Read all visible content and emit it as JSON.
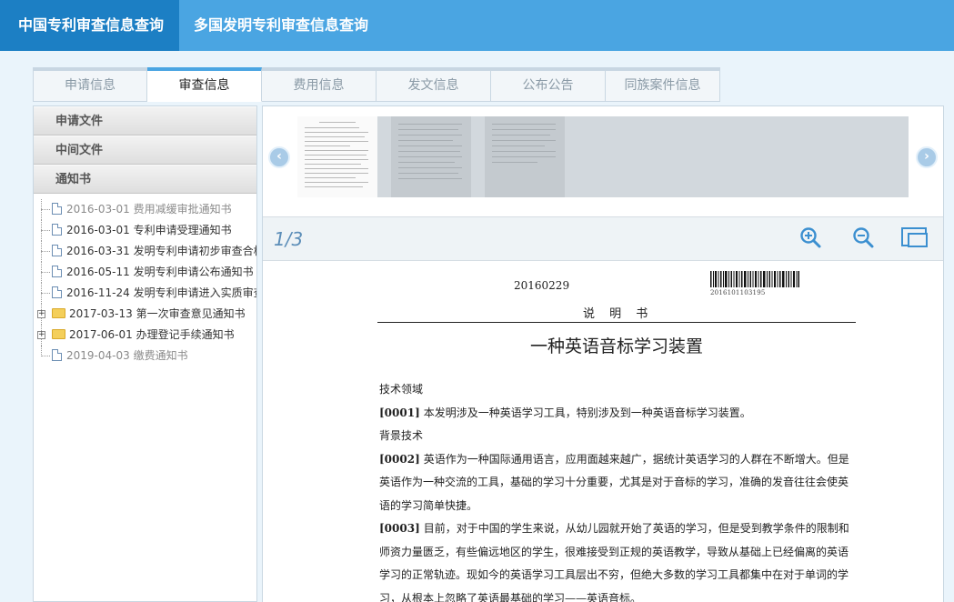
{
  "topnav": {
    "items": [
      "中国专利审查信息查询",
      "多国发明专利审查信息查询"
    ]
  },
  "tabs": [
    "申请信息",
    "审查信息",
    "费用信息",
    "发文信息",
    "公布公告",
    "同族案件信息"
  ],
  "sidebar": {
    "sections": [
      "申请文件",
      "中间文件",
      "通知书"
    ],
    "notices": [
      {
        "date": "2016-03-01",
        "label": "费用减缓审批通知书"
      },
      {
        "date": "2016-03-01",
        "label": "专利申请受理通知书"
      },
      {
        "date": "2016-03-31",
        "label": "发明专利申请初步审查合格通知书"
      },
      {
        "date": "2016-05-11",
        "label": "发明专利申请公布通知书"
      },
      {
        "date": "2016-11-24",
        "label": "发明专利申请进入实质审查阶段通知书"
      },
      {
        "date": "2017-03-13",
        "label": "第一次审查意见通知书"
      },
      {
        "date": "2017-06-01",
        "label": "办理登记手续通知书"
      },
      {
        "date": "2019-04-03",
        "label": "缴费通知书"
      }
    ]
  },
  "viewer": {
    "page_indicator": "1/3",
    "icons": [
      "zoom-in-icon",
      "zoom-out-icon",
      "fit-page-icon",
      "prev-arrow-icon",
      "next-arrow-icon"
    ]
  },
  "document": {
    "date": "20160229",
    "barcode_number": "2016101103195",
    "subtitle": "说 明 书",
    "title": "一种英语音标学习装置",
    "body": [
      {
        "type": "heading",
        "text": "技术领域"
      },
      {
        "type": "para",
        "num": "[0001]",
        "text": "本发明涉及一种英语学习工具，特别涉及到一种英语音标学习装置。"
      },
      {
        "type": "heading",
        "text": "背景技术"
      },
      {
        "type": "para",
        "num": "[0002]",
        "text": "英语作为一种国际通用语言，应用面越来越广，据统计英语学习的人群在不断增大。但是英语作为一种交流的工具，基础的学习十分重要，尤其是对于音标的学习，准确的发音往往会使英语的学习简单快捷。"
      },
      {
        "type": "para",
        "num": "[0003]",
        "text": "目前，对于中国的学生来说，从幼儿园就开始了英语的学习，但是受到教学条件的限制和师资力量匮乏，有些偏远地区的学生，很难接受到正规的英语教学，导致从基础上已经偏离的英语学习的正常轨迹。现如今的英语学习工具层出不穷，但绝大多数的学习工具都集中在对于单词的学习，从根本上忽略了英语最基础的学习——英语音标。"
      }
    ]
  },
  "colors": {
    "topbar": "#4aa5e2",
    "topbar_active": "#1c7fc4",
    "tab_active_border": "#4aa5e2",
    "page_background": "#eaf4fb"
  }
}
